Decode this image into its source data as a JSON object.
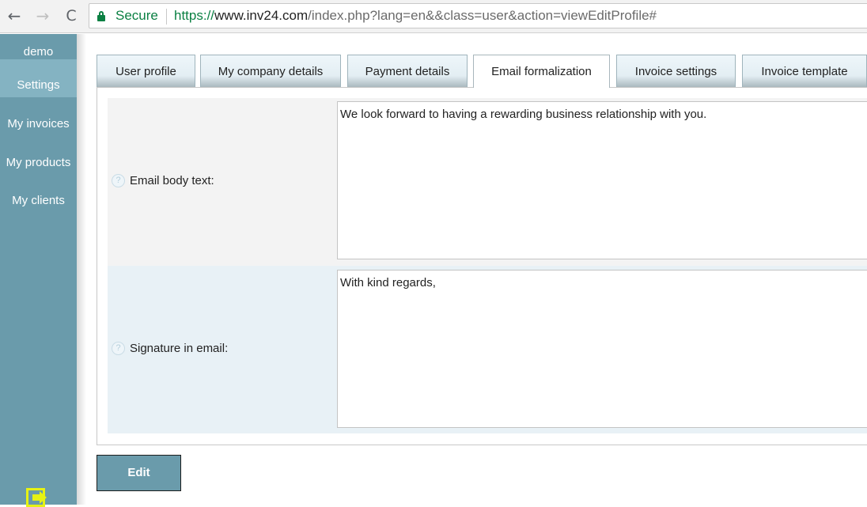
{
  "browser": {
    "back_icon": "←",
    "forward_icon": "→",
    "reload_icon": "C",
    "secure_label": "Secure",
    "url_scheme": "https://",
    "url_host": "www.inv24.com",
    "url_path": "/index.php?lang=en&&class=user&action=viewEditProfile#"
  },
  "sidebar": {
    "user": "demo",
    "items": [
      {
        "label": "Settings",
        "active": true
      },
      {
        "label": "My invoices"
      },
      {
        "label": "My products"
      },
      {
        "label": "My clients"
      }
    ],
    "logout_icon": "logout-icon"
  },
  "tabs": [
    {
      "label": "User profile"
    },
    {
      "label": "My company details"
    },
    {
      "label": "Payment details"
    },
    {
      "label": "Email formalization",
      "active": true
    },
    {
      "label": "Invoice settings"
    },
    {
      "label": "Invoice template"
    }
  ],
  "form": {
    "help_glyph": "?",
    "fields": [
      {
        "label": "Email body text:",
        "value": "We look forward to having a rewarding business relationship with you."
      },
      {
        "label": "Signature in email:",
        "value": "With kind regards,"
      }
    ]
  },
  "actions": {
    "edit_label": "Edit"
  },
  "colors": {
    "sidebar": "#6a9bab",
    "sidebar_active": "#84b3c2",
    "secure_green": "#0b8043",
    "logout_yellow": "#e6f214"
  }
}
